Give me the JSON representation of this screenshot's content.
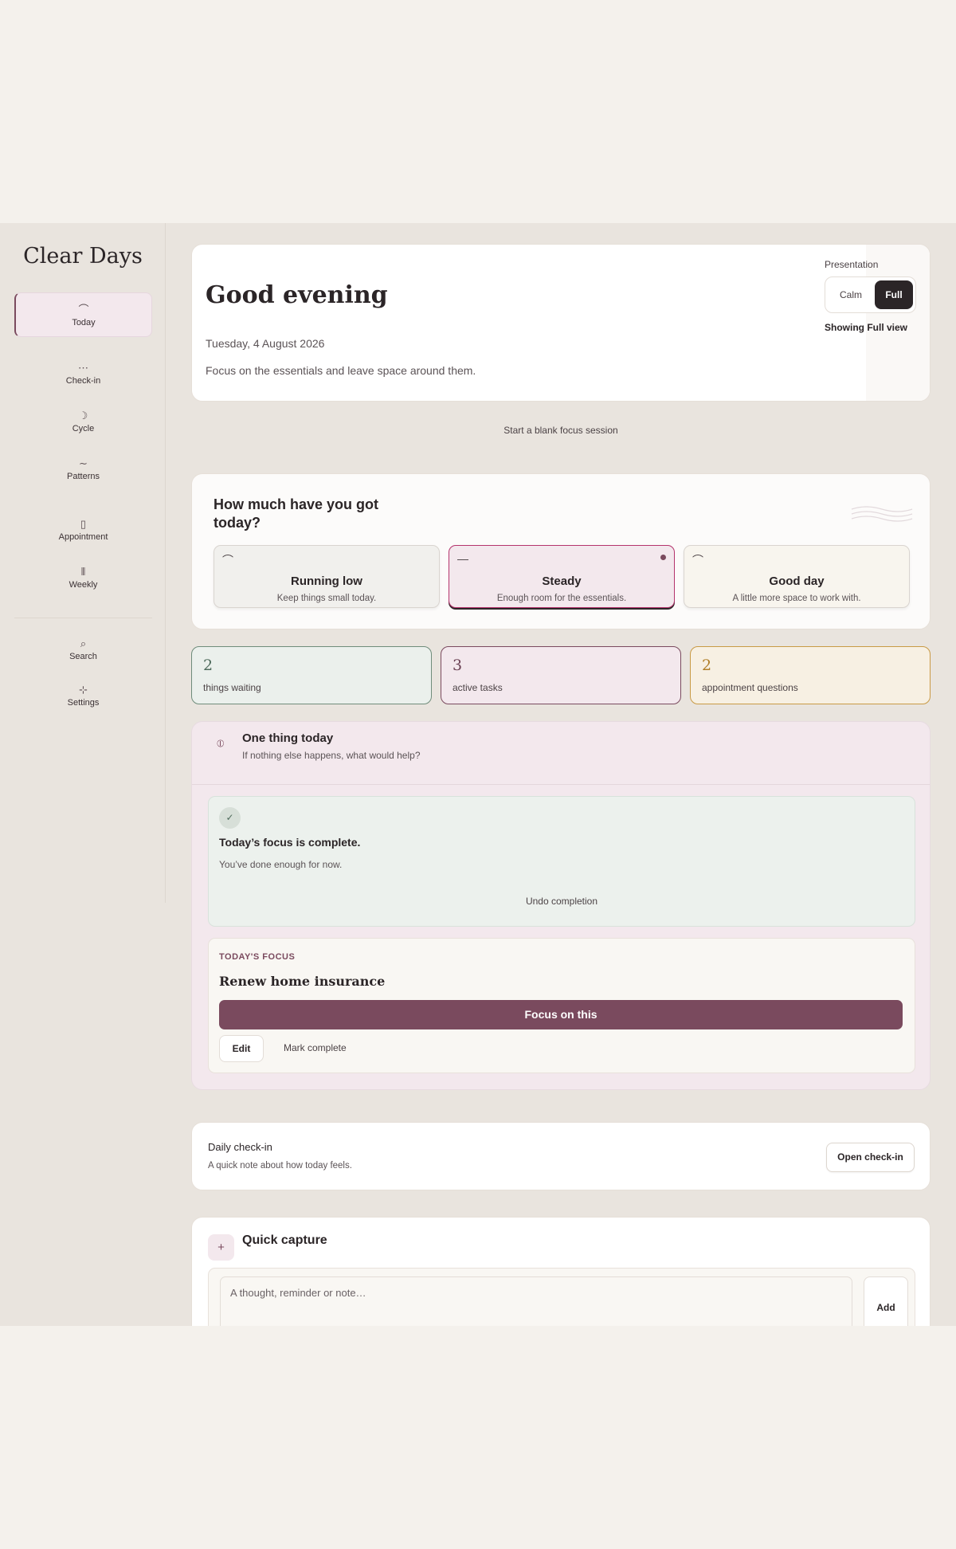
{
  "app": {
    "brand": "Clear Days"
  },
  "sidebar": {
    "items": [
      {
        "label": "Today",
        "icon": "smile-arc-icon",
        "glyph": "⌒"
      },
      {
        "label": "Check-in",
        "icon": "dots-icon",
        "glyph": "⋯"
      },
      {
        "label": "Cycle",
        "icon": "moon-icon",
        "glyph": "☽"
      },
      {
        "label": "Patterns",
        "icon": "wave-icon",
        "glyph": "∼"
      },
      {
        "label": "Appointment",
        "icon": "clipboard-icon",
        "glyph": "▯"
      },
      {
        "label": "Weekly",
        "icon": "bars-icon",
        "glyph": "⦀"
      },
      {
        "label": "Search",
        "icon": "search-icon",
        "glyph": "⌕"
      },
      {
        "label": "Settings",
        "icon": "settings-icon",
        "glyph": "⊹"
      }
    ]
  },
  "hero": {
    "title": "Good evening",
    "date": "Tuesday, 4 August 2026",
    "subtitle": "Focus on the essentials and leave space around them.",
    "presentation_label": "Presentation",
    "calm_label": "Calm",
    "full_label": "Full",
    "status": "Showing Full view"
  },
  "blank_session": "Start a blank focus session",
  "energy": {
    "question": "How much have you got today?",
    "options": [
      {
        "title": "Running low",
        "sub": "Keep things small today."
      },
      {
        "title": "Steady",
        "sub": "Enough room for the essentials."
      },
      {
        "title": "Good day",
        "sub": "A little more space to work with."
      }
    ],
    "selected": "Steady"
  },
  "stats": [
    {
      "value": "2",
      "label": "things waiting"
    },
    {
      "value": "3",
      "label": "active tasks"
    },
    {
      "value": "2",
      "label": "appointment questions"
    }
  ],
  "one_thing": {
    "title": "One thing today",
    "subtitle": "If nothing else happens, what would help?",
    "done_title": "Today’s focus is complete.",
    "done_sub": "You’ve done enough for now.",
    "undo": "Undo completion",
    "focus_label": "TODAY'S FOCUS",
    "focus_task": "Renew home insurance",
    "focus_button": "Focus on this",
    "edit": "Edit",
    "mark_complete": "Mark complete"
  },
  "checkin": {
    "title": "Daily check-in",
    "subtitle": "A quick note about how today feels.",
    "button": "Open check-in"
  },
  "capture": {
    "title": "Quick capture",
    "placeholder": "A thought, reminder or note…",
    "add": "Add"
  },
  "colors": {
    "accent": "#7a4a5e",
    "dark": "#2b2527",
    "sage": "#6f8c7b",
    "amber": "#c99a45"
  }
}
